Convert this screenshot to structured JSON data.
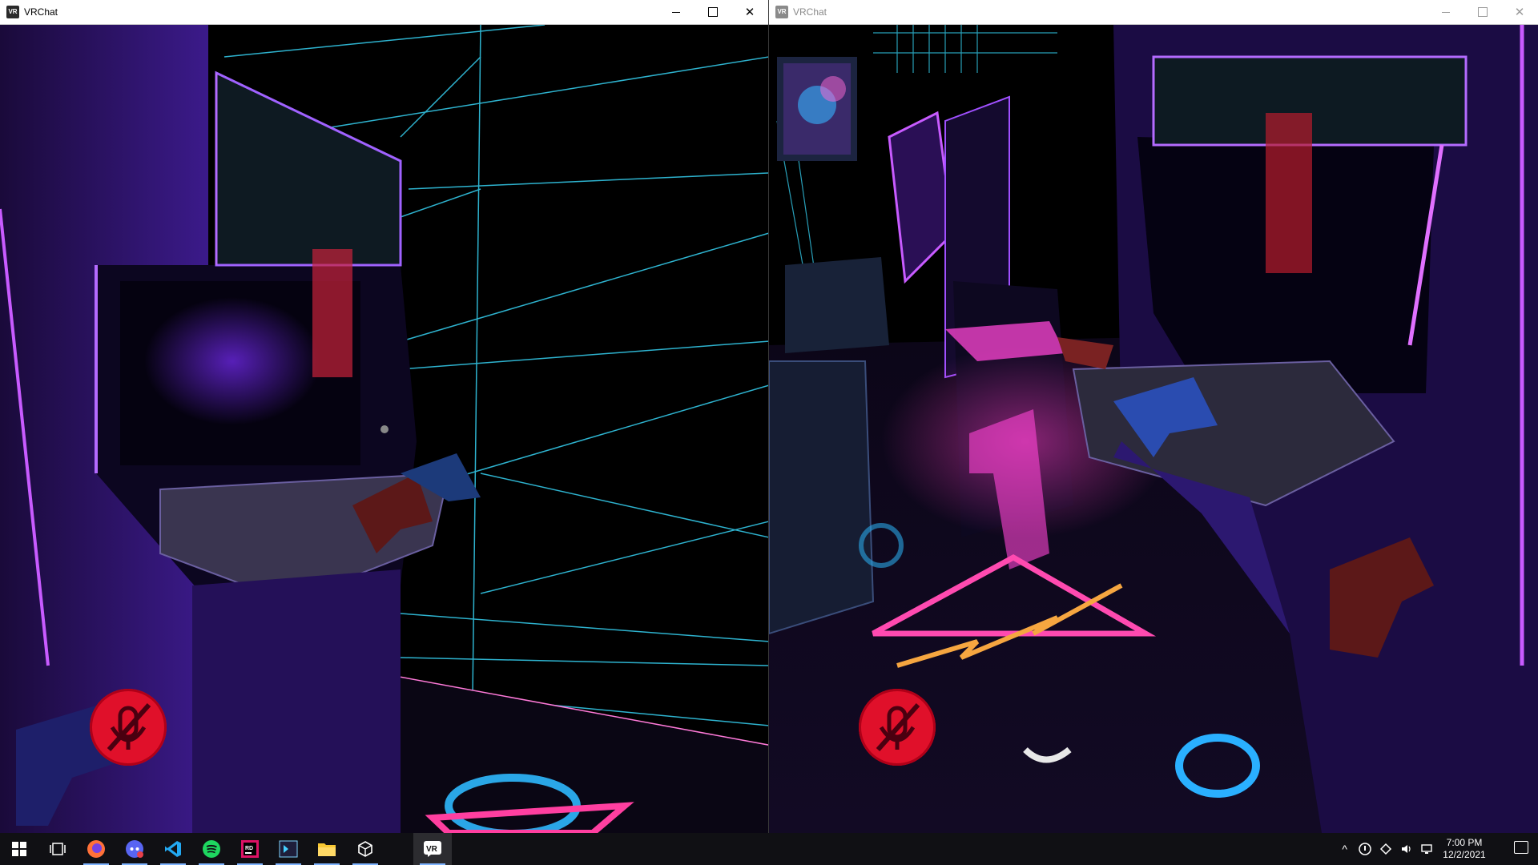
{
  "windows": [
    {
      "title": "VRChat",
      "icon": "vrchat-app-icon",
      "focused": true
    },
    {
      "title": "VRChat",
      "icon": "vrchat-app-icon",
      "focused": false
    }
  ],
  "taskbar": {
    "icons": [
      "windows-start-icon",
      "task-view-icon",
      "firefox-icon",
      "discord-icon",
      "vscode-icon",
      "spotify-icon",
      "rider-icon",
      "terminal-icon",
      "file-explorer-icon",
      "unity-icon",
      "vrchat-icon"
    ],
    "clock": {
      "time": "7:00 PM",
      "date": "12/2/2021"
    }
  },
  "colors": {
    "neon_cyan": "#33c7e6",
    "neon_pink": "#ff3fc4",
    "neon_purple": "#7a2cff",
    "mute_red": "#e0102a"
  }
}
